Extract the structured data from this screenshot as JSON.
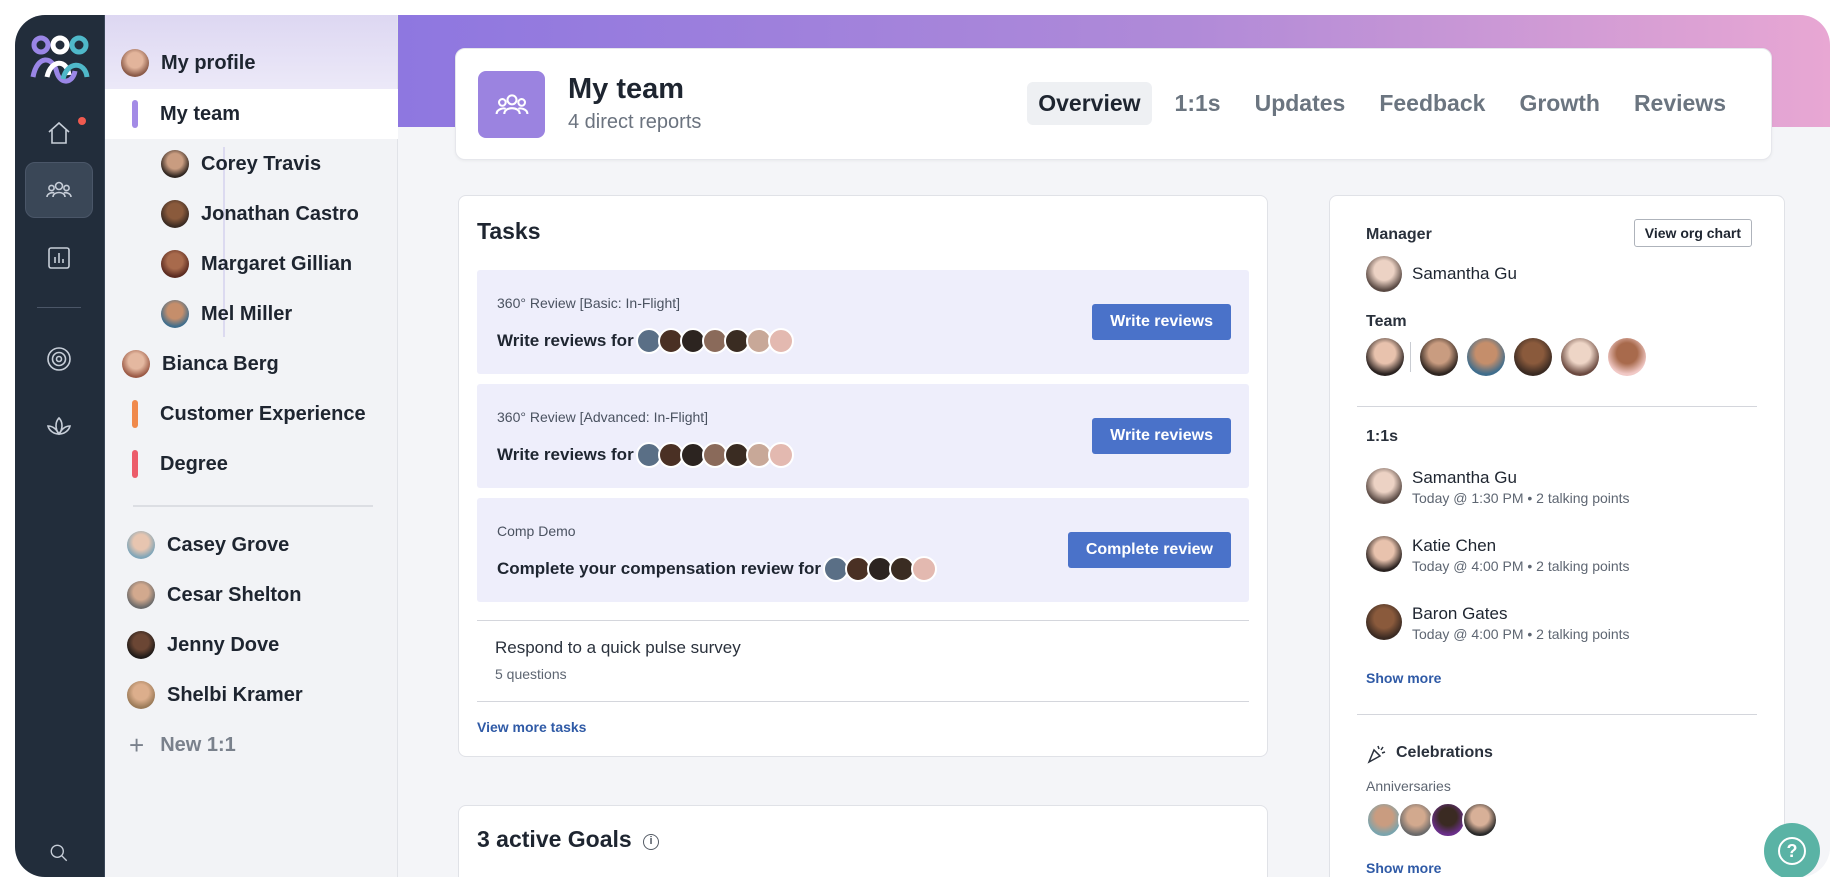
{
  "colors": {
    "accent": "#4a72c9",
    "rail": "#222d3b",
    "banner_start": "#8e77e0",
    "banner_end": "#e8a7d3",
    "help": "#5ab3a5",
    "notify": "#f05a4f"
  },
  "rail": {
    "icons": [
      "logo-icon",
      "home-icon",
      "team-icon",
      "chart-icon",
      "target-icon",
      "lotus-icon",
      "search-icon"
    ]
  },
  "sidebar": {
    "profile": "My profile",
    "myteam": "My team",
    "reports": [
      "Corey Travis",
      "Jonathan Castro",
      "Margaret Gillian",
      "Mel Miller"
    ],
    "bianca": "Bianca Berg",
    "groups": [
      {
        "label": "Customer Experience",
        "color": "#f0894b"
      },
      {
        "label": "Degree",
        "color": "#ec5c6a"
      }
    ],
    "oneonones": [
      "Casey Grove",
      "Cesar Shelton",
      "Jenny Dove",
      "Shelbi Kramer"
    ],
    "new_label": "New 1:1",
    "new_icon": "plus-icon"
  },
  "header": {
    "title": "My team",
    "subtitle": "4 direct reports",
    "badge_icon": "team-icon",
    "tabs": [
      "Overview",
      "1:1s",
      "Updates",
      "Feedback",
      "Growth",
      "Reviews"
    ],
    "active_tab": "Overview"
  },
  "tasks": {
    "title": "Tasks",
    "items": [
      {
        "label": "360° Review [Basic: In-Flight]",
        "text": "Write reviews for",
        "button": "Write reviews"
      },
      {
        "label": "360° Review [Advanced: In-Flight]",
        "text": "Write reviews for",
        "button": "Write reviews"
      },
      {
        "label": "Comp Demo",
        "text": "Complete your compensation review for",
        "button": "Complete review"
      }
    ],
    "pulse_title": "Respond to a quick pulse survey",
    "pulse_sub": "5 questions",
    "view_more": "View more tasks"
  },
  "goals": {
    "title": "3 active Goals",
    "info_icon": "info-icon",
    "info_glyph": "i"
  },
  "panel": {
    "manager_label": "Manager",
    "manager_name": "Samantha Gu",
    "org_button": "View org chart",
    "team_label": "Team",
    "oneonones_label": "1:1s",
    "meetings": [
      {
        "name": "Samantha Gu",
        "time": "Today @ 1:30 PM • 2 talking points"
      },
      {
        "name": "Katie Chen",
        "time": "Today @ 4:00 PM • 2 talking points"
      },
      {
        "name": "Baron Gates",
        "time": "Today @ 4:00 PM • 2 talking points"
      }
    ],
    "show_more": "Show more",
    "celebrations_label": "Celebrations",
    "celebrations_icon": "party-icon",
    "anniversaries_label": "Anniversaries",
    "show_more2": "Show more"
  },
  "help": {
    "icon": "help-icon",
    "glyph": "?"
  }
}
